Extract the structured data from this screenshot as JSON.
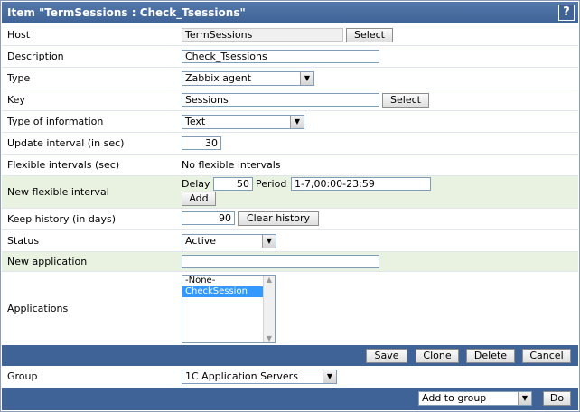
{
  "title": "Item \"TermSessions : Check_Tsessions\"",
  "help_label": "?",
  "host": {
    "label": "Host",
    "value": "TermSessions",
    "select_label": "Select"
  },
  "description": {
    "label": "Description",
    "value": "Check_Tsessions"
  },
  "type": {
    "label": "Type",
    "value": "Zabbix agent"
  },
  "key": {
    "label": "Key",
    "value": "Sessions",
    "select_label": "Select"
  },
  "type_of_information": {
    "label": "Type of information",
    "value": "Text"
  },
  "update_interval": {
    "label": "Update interval (in sec)",
    "value": "30"
  },
  "flexible_intervals": {
    "label": "Flexible intervals (sec)",
    "value": "No flexible intervals"
  },
  "new_flexible_interval": {
    "label": "New flexible interval",
    "delay_label": "Delay",
    "delay_value": "50",
    "period_label": "Period",
    "period_value": "1-7,00:00-23:59",
    "add_label": "Add"
  },
  "keep_history": {
    "label": "Keep history (in days)",
    "value": "90",
    "clear_label": "Clear history"
  },
  "status": {
    "label": "Status",
    "value": "Active"
  },
  "new_application": {
    "label": "New application",
    "value": ""
  },
  "applications": {
    "label": "Applications",
    "options": [
      "-None-",
      "CheckSession"
    ],
    "selected": "CheckSession"
  },
  "actions": {
    "save": "Save",
    "clone": "Clone",
    "delete": "Delete",
    "cancel": "Cancel"
  },
  "group": {
    "label": "Group",
    "value": "1C Application Servers"
  },
  "footer": {
    "action_value": "Add to group",
    "do_label": "Do"
  },
  "colors": {
    "header": "#3f6396",
    "highlight_row": "#e9f2e1",
    "selection": "#3399ff"
  }
}
